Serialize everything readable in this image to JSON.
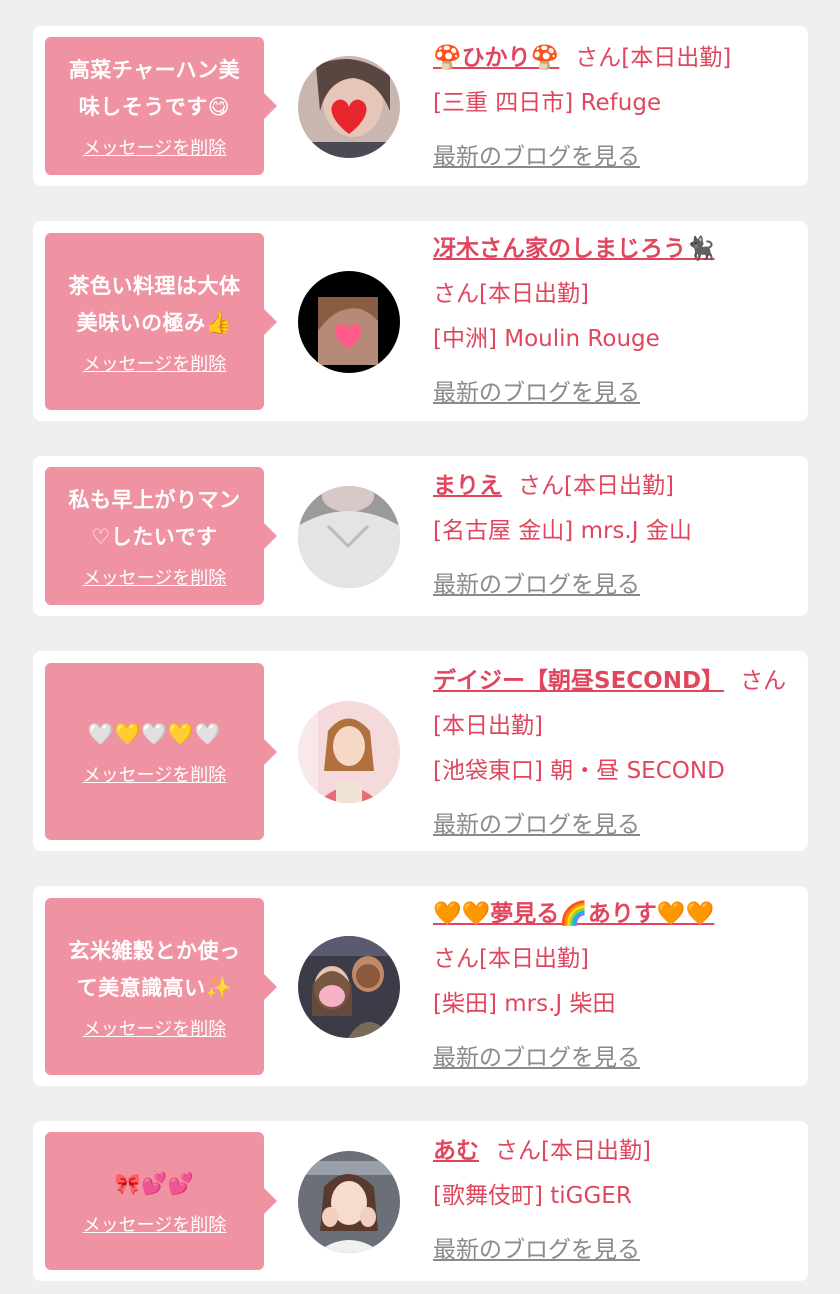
{
  "delete_label": "メッセージを削除",
  "blog_label": "最新のブログを見る",
  "colors": {
    "page_bg": "#efefef",
    "bubble": "#ef93a2",
    "accent": "#e0475f",
    "blog_link": "#8a8a8a"
  },
  "messages": [
    {
      "text": "高菜チャーハン美\n味しそうです😋",
      "name": "🍄ひかり🍄",
      "san": "さん[本日出勤]",
      "shop": "[三重 四日市] Refuge",
      "avatar": "avatar-face-heart-sticker"
    },
    {
      "text": "茶色い料理は大体\n美味いの極み👍",
      "name": "冴木さん家のしまじろう🐈‍⬛",
      "san": "さん[本日出勤]",
      "shop": "[中洲] Moulin Rouge",
      "avatar": "avatar-dark-heart-sticker"
    },
    {
      "text": "私も早上がりマン\n♡したいです",
      "name": "まりえ",
      "san": "さん[本日出勤]",
      "shop": "[名古屋 金山] mrs.J 金山",
      "avatar": "avatar-grey-shirt"
    },
    {
      "text": "🤍💛🤍💛🤍",
      "name": "デイジー【朝昼SECOND】",
      "san": "さん[本日出勤]",
      "shop": "[池袋東口] 朝・昼 SECOND",
      "avatar": "avatar-pink-dress"
    },
    {
      "text": "玄米雑穀とか使っ\nて美意識高い✨",
      "name": "🧡🧡夢見る🌈ありす🧡🧡",
      "san": "さん[本日出勤]",
      "shop": "[柴田] mrs.J 柴田",
      "avatar": "avatar-couple-stickers"
    },
    {
      "text": "🎀💕💕",
      "name": "あむ",
      "san": "さん[本日出勤]",
      "shop": "[歌舞伎町] tiGGER",
      "avatar": "avatar-hands-cheeks"
    }
  ]
}
